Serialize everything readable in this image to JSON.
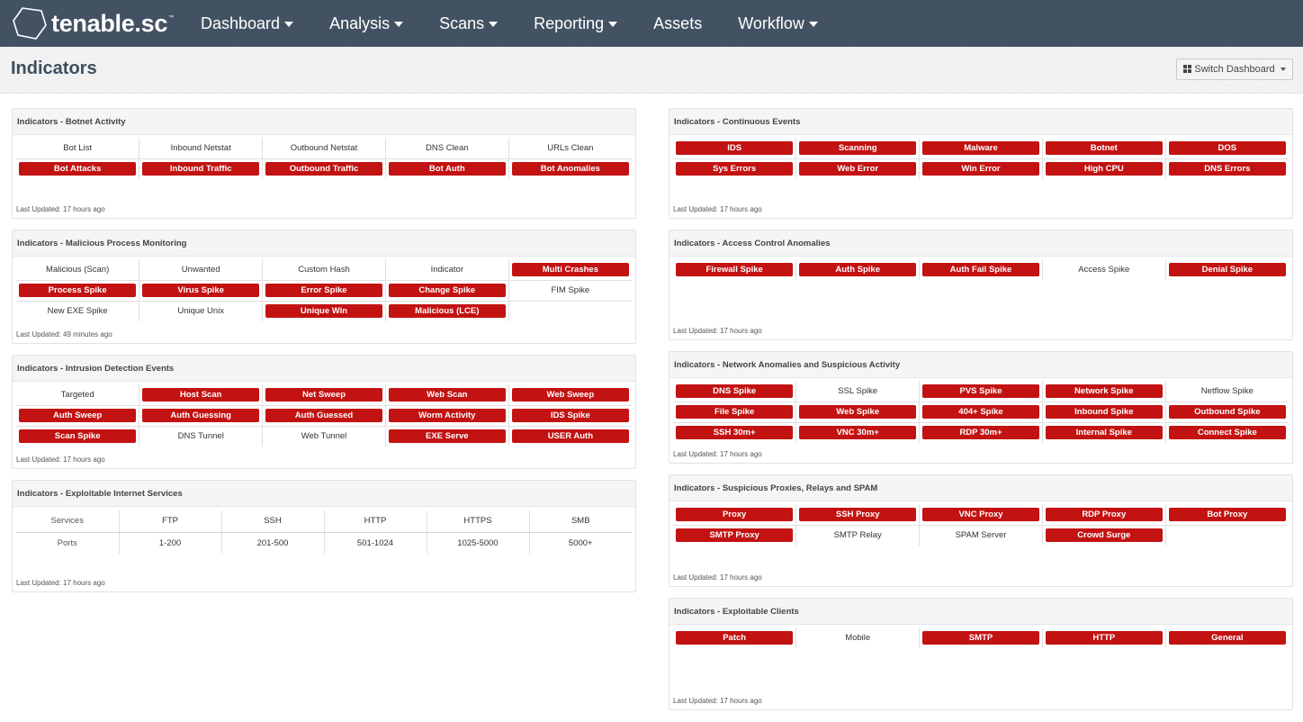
{
  "app": {
    "logo_text": "tenable.sc",
    "nav": [
      {
        "label": "Dashboard",
        "dropdown": true
      },
      {
        "label": "Analysis",
        "dropdown": true
      },
      {
        "label": "Scans",
        "dropdown": true
      },
      {
        "label": "Reporting",
        "dropdown": true
      },
      {
        "label": "Assets",
        "dropdown": false
      },
      {
        "label": "Workflow",
        "dropdown": true
      }
    ]
  },
  "page": {
    "title": "Indicators",
    "switch_dashboard_label": "Switch Dashboard"
  },
  "colors": {
    "alert": "#c31212",
    "nav_bg": "#435263"
  },
  "left_panels": [
    {
      "title": "Indicators - Botnet Activity",
      "rows": [
        [
          {
            "label": "Bot List",
            "alert": false
          },
          {
            "label": "Inbound Netstat",
            "alert": false
          },
          {
            "label": "Outbound Netstat",
            "alert": false
          },
          {
            "label": "DNS Clean",
            "alert": false
          },
          {
            "label": "URLs Clean",
            "alert": false
          }
        ],
        [
          {
            "label": "Bot Attacks",
            "alert": true
          },
          {
            "label": "Inbound Traffic",
            "alert": true
          },
          {
            "label": "Outbound Traffic",
            "alert": true
          },
          {
            "label": "Bot Auth",
            "alert": true
          },
          {
            "label": "Bot Anomalies",
            "alert": true
          }
        ]
      ],
      "last_updated": "Last Updated: 17 hours ago"
    },
    {
      "title": "Indicators - Malicious Process Monitoring",
      "rows": [
        [
          {
            "label": "Malicious (Scan)",
            "alert": false
          },
          {
            "label": "Unwanted",
            "alert": false
          },
          {
            "label": "Custom Hash",
            "alert": false
          },
          {
            "label": "Indicator",
            "alert": false
          },
          {
            "label": "Multi Crashes",
            "alert": true
          }
        ],
        [
          {
            "label": "Process Spike",
            "alert": true
          },
          {
            "label": "Virus Spike",
            "alert": true
          },
          {
            "label": "Error Spike",
            "alert": true
          },
          {
            "label": "Change Spike",
            "alert": true
          },
          {
            "label": "FIM Spike",
            "alert": false
          }
        ],
        [
          {
            "label": "New EXE Spike",
            "alert": false
          },
          {
            "label": "Unique Unix",
            "alert": false
          },
          {
            "label": "Unique Win",
            "alert": true
          },
          {
            "label": "Malicious (LCE)",
            "alert": true
          },
          {
            "label": "",
            "alert": false
          }
        ]
      ],
      "last_updated": "Last Updated: 49 minutes ago"
    },
    {
      "title": "Indicators - Intrusion Detection Events",
      "rows": [
        [
          {
            "label": "Targeted",
            "alert": false
          },
          {
            "label": "Host Scan",
            "alert": true
          },
          {
            "label": "Net Sweep",
            "alert": true
          },
          {
            "label": "Web Scan",
            "alert": true
          },
          {
            "label": "Web Sweep",
            "alert": true
          }
        ],
        [
          {
            "label": "Auth Sweep",
            "alert": true
          },
          {
            "label": "Auth Guessing",
            "alert": true
          },
          {
            "label": "Auth Guessed",
            "alert": true
          },
          {
            "label": "Worm Activity",
            "alert": true
          },
          {
            "label": "IDS Spike",
            "alert": true
          }
        ],
        [
          {
            "label": "Scan Spike",
            "alert": true
          },
          {
            "label": "DNS Tunnel",
            "alert": false
          },
          {
            "label": "Web Tunnel",
            "alert": false
          },
          {
            "label": "EXE Serve",
            "alert": true
          },
          {
            "label": "USER Auth",
            "alert": true
          }
        ]
      ],
      "last_updated": "Last Updated: 17 hours ago"
    }
  ],
  "services_panel": {
    "title": "Indicators - Exploitable Internet Services",
    "header_row": [
      "Services",
      "FTP",
      "SSH",
      "HTTP",
      "HTTPS",
      "SMB"
    ],
    "value_row": [
      "Ports",
      "1-200",
      "201-500",
      "501-1024",
      "1025-5000",
      "5000+"
    ],
    "last_updated": "Last Updated: 17 hours ago"
  },
  "right_panels": [
    {
      "title": "Indicators - Continuous Events",
      "rows": [
        [
          {
            "label": "IDS",
            "alert": true
          },
          {
            "label": "Scanning",
            "alert": true
          },
          {
            "label": "Malware",
            "alert": true
          },
          {
            "label": "Botnet",
            "alert": true
          },
          {
            "label": "DOS",
            "alert": true
          }
        ],
        [
          {
            "label": "Sys Errors",
            "alert": true
          },
          {
            "label": "Web Error",
            "alert": true
          },
          {
            "label": "Win Error",
            "alert": true
          },
          {
            "label": "High CPU",
            "alert": true
          },
          {
            "label": "DNS Errors",
            "alert": true
          }
        ]
      ],
      "last_updated": "Last Updated: 17 hours ago"
    },
    {
      "title": "Indicators - Access Control Anomalies",
      "rows": [
        [
          {
            "label": "Firewall Spike",
            "alert": true
          },
          {
            "label": "Auth Spike",
            "alert": true
          },
          {
            "label": "Auth Fail Spike",
            "alert": true
          },
          {
            "label": "Access Spike",
            "alert": false
          },
          {
            "label": "Denial Spike",
            "alert": true
          }
        ]
      ],
      "last_updated": "Last Updated: 17 hours ago"
    },
    {
      "title": "Indicators - Network Anomalies and Suspicious Activity",
      "rows": [
        [
          {
            "label": "DNS Spike",
            "alert": true
          },
          {
            "label": "SSL Spike",
            "alert": false
          },
          {
            "label": "PVS Spike",
            "alert": true
          },
          {
            "label": "Network Spike",
            "alert": true
          },
          {
            "label": "Netflow Spike",
            "alert": false
          }
        ],
        [
          {
            "label": "File Spike",
            "alert": true
          },
          {
            "label": "Web Spike",
            "alert": true
          },
          {
            "label": "404+ Spike",
            "alert": true
          },
          {
            "label": "Inbound Spike",
            "alert": true
          },
          {
            "label": "Outbound Spike",
            "alert": true
          }
        ],
        [
          {
            "label": "SSH 30m+",
            "alert": true
          },
          {
            "label": "VNC 30m+",
            "alert": true
          },
          {
            "label": "RDP 30m+",
            "alert": true
          },
          {
            "label": "Internal Spike",
            "alert": true
          },
          {
            "label": "Connect Spike",
            "alert": true
          }
        ]
      ],
      "last_updated": "Last Updated: 17 hours ago"
    },
    {
      "title": "Indicators - Suspicious Proxies, Relays and SPAM",
      "rows": [
        [
          {
            "label": "Proxy",
            "alert": true
          },
          {
            "label": "SSH Proxy",
            "alert": true
          },
          {
            "label": "VNC Proxy",
            "alert": true
          },
          {
            "label": "RDP Proxy",
            "alert": true
          },
          {
            "label": "Bot Proxy",
            "alert": true
          }
        ],
        [
          {
            "label": "SMTP Proxy",
            "alert": true
          },
          {
            "label": "SMTP Relay",
            "alert": false
          },
          {
            "label": "SPAM Server",
            "alert": false
          },
          {
            "label": "Crowd Surge",
            "alert": true
          },
          {
            "label": "",
            "alert": false
          }
        ]
      ],
      "last_updated": "Last Updated: 17 hours ago"
    },
    {
      "title": "Indicators - Exploitable Clients",
      "rows": [
        [
          {
            "label": "Patch",
            "alert": true
          },
          {
            "label": "Mobile",
            "alert": false
          },
          {
            "label": "SMTP",
            "alert": true
          },
          {
            "label": "HTTP",
            "alert": true
          },
          {
            "label": "General",
            "alert": true
          }
        ]
      ],
      "last_updated": "Last Updated: 17 hours ago"
    }
  ]
}
